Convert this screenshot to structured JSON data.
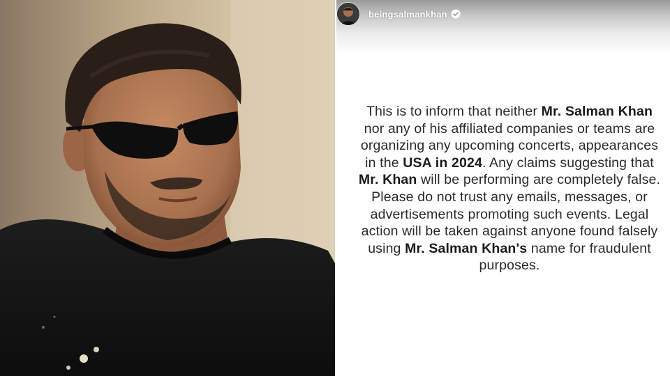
{
  "story": {
    "username": "beingsalmankhan",
    "verified_icon": "verified-badge-icon",
    "statement": [
      {
        "t": "This is to inform that neither ",
        "b": false
      },
      {
        "t": "Mr. Salman Khan",
        "b": true
      },
      {
        "t": " nor any of his affiliated companies or teams are organizing any upcoming concerts, appearances in the ",
        "b": false
      },
      {
        "t": "USA in 2024",
        "b": true
      },
      {
        "t": ". Any claims suggesting that ",
        "b": false
      },
      {
        "t": "Mr. Khan",
        "b": true
      },
      {
        "t": " will be performing are completely false. Please do not trust any emails, messages, or advertisements promoting such events. Legal action will be taken against anyone found falsely using ",
        "b": false
      },
      {
        "t": "Mr. Salman Khan's",
        "b": true
      },
      {
        "t": " name for fraudulent purposes.",
        "b": false
      }
    ]
  },
  "photo": {
    "subject": "portrait-photo",
    "colors": {
      "background": "#c9b79a",
      "skin": "#a9704e",
      "hair": "#2a1e18",
      "shirt": "#151515",
      "sunglasses": "#0e0e0e"
    }
  }
}
